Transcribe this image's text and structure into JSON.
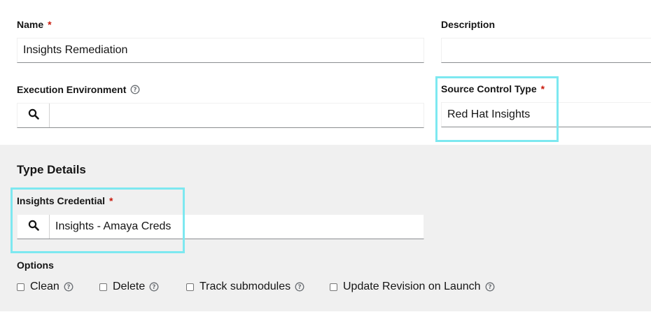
{
  "form": {
    "name": {
      "label": "Name",
      "required": "*",
      "value": "Insights Remediation"
    },
    "description": {
      "label": "Description",
      "value": ""
    },
    "execution_environment": {
      "label": "Execution Environment",
      "value": ""
    },
    "source_control_type": {
      "label": "Source Control Type",
      "required": "*",
      "value": "Red Hat Insights"
    }
  },
  "type_details": {
    "title": "Type Details",
    "insights_credential": {
      "label": "Insights Credential",
      "required": "*",
      "value": "Insights - Amaya Creds"
    },
    "options": {
      "label": "Options",
      "items": [
        {
          "label": "Clean",
          "checked": false
        },
        {
          "label": "Delete",
          "checked": false
        },
        {
          "label": "Track submodules",
          "checked": false
        },
        {
          "label": "Update Revision on Launch",
          "checked": false
        }
      ]
    }
  },
  "icons": {
    "search": "search-icon",
    "help": "help-icon"
  },
  "colors": {
    "required": "#c9190b",
    "highlight": "#7de8f0",
    "section_bg": "#f0f0f0"
  }
}
